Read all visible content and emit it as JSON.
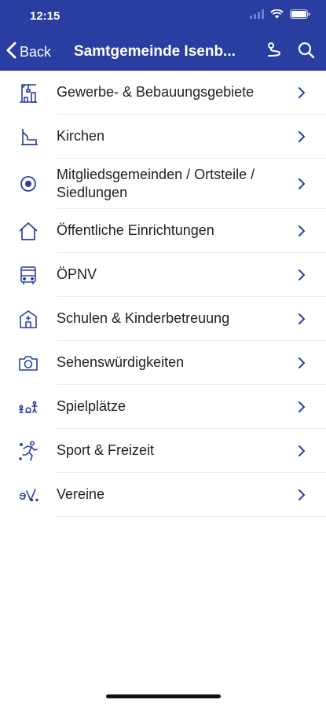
{
  "status_bar": {
    "time": "12:15"
  },
  "nav": {
    "back_label": "Back",
    "title": "Samtgemeinde Isenb..."
  },
  "colors": {
    "accent": "#2a3ea2",
    "text": "#222222",
    "divider": "#ececec"
  },
  "items": [
    {
      "label": "Gewerbe- & Bebauungsgebiete",
      "icon": "construction-crane-icon"
    },
    {
      "label": "Kirchen",
      "icon": "church-icon"
    },
    {
      "label": "Mitgliedsgemeinden / Ortsteile / Siedlungen",
      "icon": "location-dot-icon"
    },
    {
      "label": "Öffentliche Einrichtungen",
      "icon": "house-icon"
    },
    {
      "label": "ÖPNV",
      "icon": "bus-icon"
    },
    {
      "label": "Schulen & Kinderbetreuung",
      "icon": "school-icon"
    },
    {
      "label": "Sehenswürdigkeiten",
      "icon": "camera-icon"
    },
    {
      "label": "Spielplätze",
      "icon": "playground-icon"
    },
    {
      "label": "Sport & Freizeit",
      "icon": "running-person-icon"
    },
    {
      "label": "Vereine",
      "icon": "ev-association-icon"
    }
  ]
}
